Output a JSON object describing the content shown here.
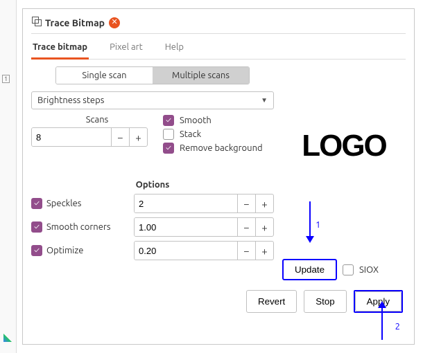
{
  "dialog": {
    "title": "Trace Bitmap"
  },
  "tabs": {
    "trace": "Trace bitmap",
    "pixel": "Pixel art",
    "help": "Help"
  },
  "scanmode": {
    "single": "Single scan",
    "multi": "Multiple scans"
  },
  "mode_dropdown": "Brightness steps",
  "scans": {
    "label": "Scans",
    "value": "8"
  },
  "checks": {
    "smooth": "Smooth",
    "stack": "Stack",
    "removebg": "Remove background"
  },
  "options": {
    "heading": "Options",
    "speckles": {
      "label": "Speckles",
      "value": "2"
    },
    "smoothcorners": {
      "label": "Smooth corners",
      "value": "1.00"
    },
    "optimize": {
      "label": "Optimize",
      "value": "0.20"
    }
  },
  "preview": {
    "logo_text": "LOGO"
  },
  "buttons": {
    "update": "Update",
    "siox": "SIOX",
    "revert": "Revert",
    "stop": "Stop",
    "apply": "Apply"
  },
  "annotations": {
    "n1": "1",
    "n2": "2"
  },
  "rail": {
    "panel": "1"
  }
}
